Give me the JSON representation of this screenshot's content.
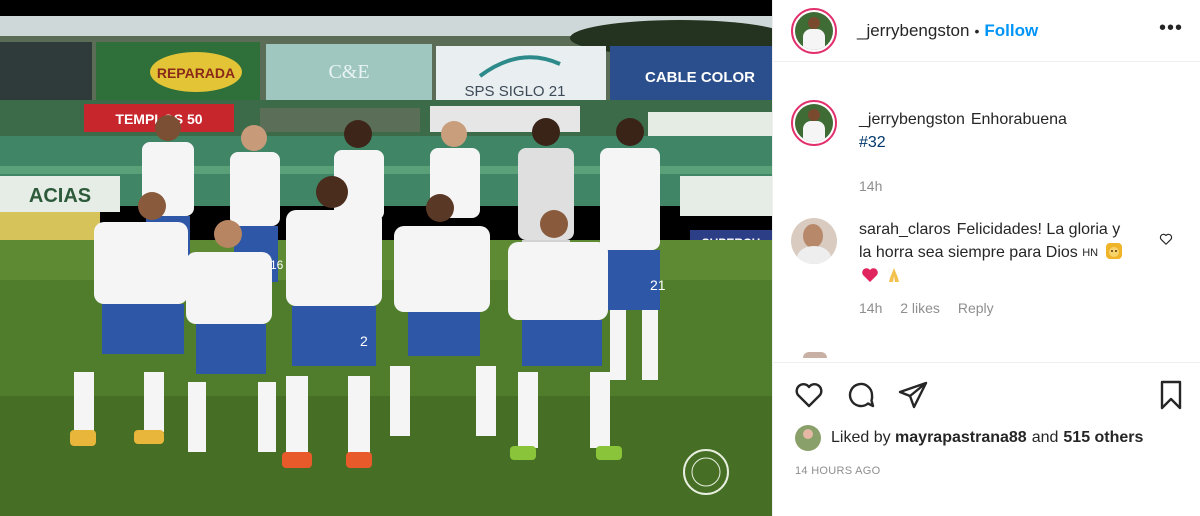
{
  "post": {
    "username": "_jerrybengston",
    "follow_label": "Follow",
    "separator": "•",
    "more_label": "•••"
  },
  "caption": {
    "username": "_jerrybengston",
    "text": "Enhorabuena",
    "hashtag": "#32",
    "time": "14h"
  },
  "comments": [
    {
      "username": "sarah_claros",
      "text": "Felicidades! La gloria y la horra sea siempre para Dios",
      "flag_text": "HN",
      "time": "14h",
      "likes": "2 likes",
      "reply_label": "Reply"
    }
  ],
  "photo": {
    "billboards": [
      "CABLE COLOR",
      "SPS SIGLO 21",
      "C&E",
      "REPARADA",
      "TEMPLOS 50",
      "SUPERCH",
      "ACIAS"
    ],
    "players_numbers": [
      "16",
      "2",
      "21"
    ]
  },
  "likes": {
    "prefix": "Liked by",
    "user": "mayrapastrana88",
    "connector": "and",
    "others": "515 others"
  },
  "timestamp": "14 HOURS AGO",
  "colors": {
    "accent_blue": "#0095f6",
    "story_ring": "#e1306c",
    "muted": "#8e8e8e",
    "jersey_white": "#f5f5f5",
    "shorts_blue": "#2e57a8",
    "grass": "#4f7d2b"
  },
  "icons": {
    "like": "heart-icon",
    "comment": "comment-icon",
    "share": "paper-plane-icon",
    "save": "bookmark-icon",
    "comment_like": "heart-outline-icon"
  }
}
